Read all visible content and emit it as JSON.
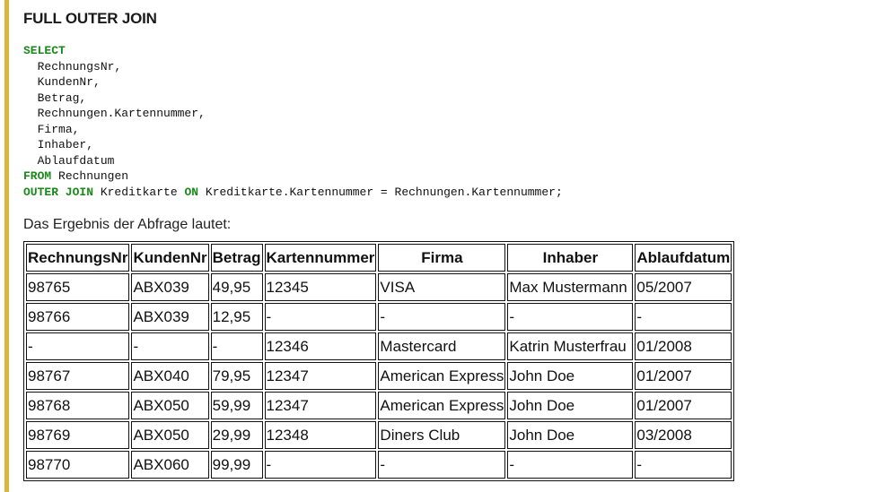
{
  "title": "FULL OUTER JOIN",
  "code": {
    "kw_select": "SELECT",
    "cols": [
      "RechnungsNr,",
      "KundenNr,",
      "Betrag,",
      "Rechnungen.Kartennummer,",
      "Firma,",
      "Inhaber,",
      "Ablaufdatum"
    ],
    "kw_from": "FROM",
    "from_table": "Rechnungen",
    "kw_outer_join": "OUTER JOIN",
    "join_table": "Kreditkarte",
    "kw_on": "ON",
    "on_condition": "Kreditkarte.Kartennummer = Rechnungen.Kartennummer;"
  },
  "result_label": "Das Ergebnis der Abfrage lautet:",
  "table": {
    "headers": [
      "RechnungsNr",
      "KundenNr",
      "Betrag",
      "Kartennummer",
      "Firma",
      "Inhaber",
      "Ablaufdatum"
    ],
    "rows": [
      [
        "98765",
        "ABX039",
        "49,95",
        "12345",
        "VISA",
        "Max Mustermann",
        "05/2007"
      ],
      [
        "98766",
        "ABX039",
        "12,95",
        "-",
        "-",
        "-",
        "-"
      ],
      [
        "-",
        "-",
        "-",
        "12346",
        "Mastercard",
        "Katrin Musterfrau",
        "01/2008"
      ],
      [
        "98767",
        "ABX040",
        "79,95",
        "12347",
        "American Express",
        "John Doe",
        "01/2007"
      ],
      [
        "98768",
        "ABX050",
        "59,99",
        "12347",
        "American Express",
        "John Doe",
        "01/2007"
      ],
      [
        "98769",
        "ABX050",
        "29,99",
        "12348",
        "Diners Club",
        "John Doe",
        "03/2008"
      ],
      [
        "98770",
        "ABX060",
        "99,99",
        "-",
        "-",
        "-",
        "-"
      ]
    ]
  },
  "colors": {
    "accent_bar": "#dcb53a",
    "keyword": "#1a8a1a"
  }
}
